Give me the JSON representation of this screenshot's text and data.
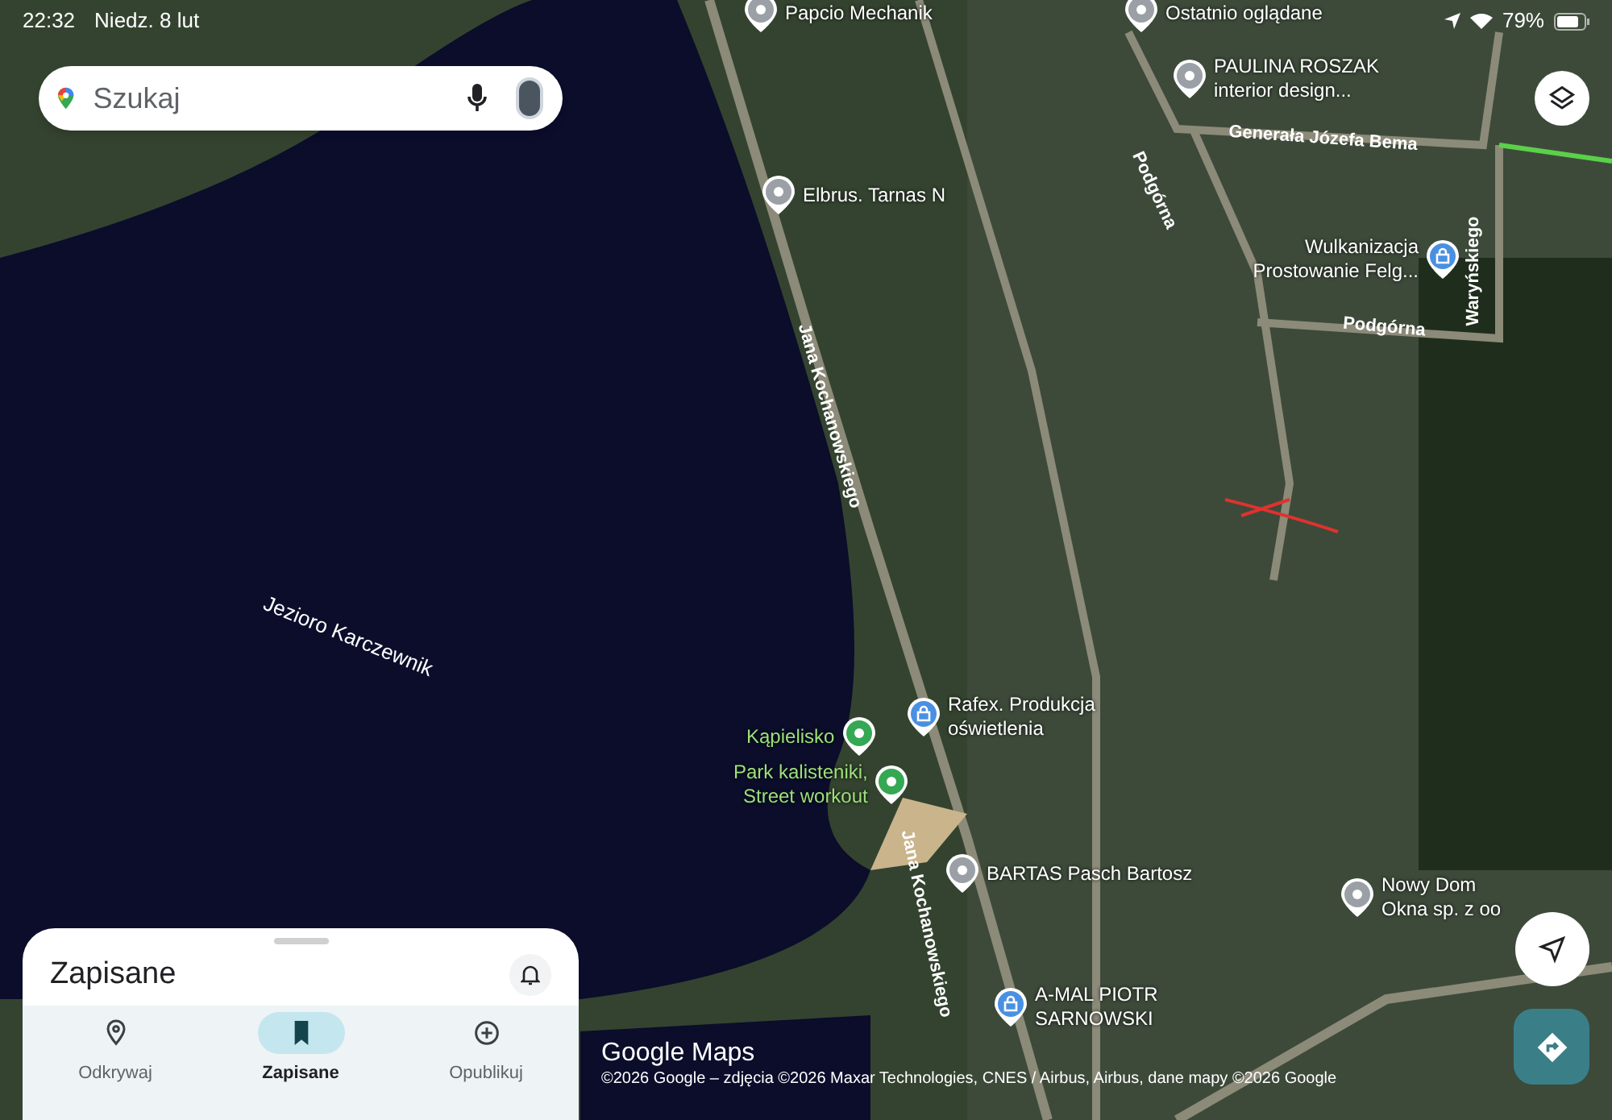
{
  "status_bar": {
    "time": "22:32",
    "date": "Niedz. 8 lut",
    "battery": "79%"
  },
  "search": {
    "placeholder": "Szukaj"
  },
  "map": {
    "water_label": "Jezioro Karczewnik",
    "roads": [
      {
        "name": "Generała Józefa Bema"
      },
      {
        "name": "Podgórna"
      },
      {
        "name": "Podgórna"
      },
      {
        "name": "Waryńskiego"
      },
      {
        "name": "Jana Kochanowskiego"
      },
      {
        "name": "Jana Kochanowskiego"
      }
    ],
    "places": [
      {
        "kind": "place",
        "lines": [
          "Papcio Mechanik"
        ]
      },
      {
        "kind": "place",
        "lines": [
          "Ostatnio oglądane"
        ]
      },
      {
        "kind": "place",
        "lines": [
          "PAULINA ROSZAK",
          "interior design..."
        ]
      },
      {
        "kind": "place",
        "lines": [
          "Elbrus. Tarnas N"
        ]
      },
      {
        "kind": "shop",
        "lines": [
          "Wulkanizacja",
          "Prostowanie Felg..."
        ]
      },
      {
        "kind": "shop",
        "lines": [
          "Rafex. Produkcja",
          "oświetlenia"
        ]
      },
      {
        "kind": "park",
        "lines": [
          "Kąpielisko"
        ]
      },
      {
        "kind": "park",
        "lines": [
          "Park kalisteniki,",
          "Street workout"
        ]
      },
      {
        "kind": "place",
        "lines": [
          "BARTAS Pasch Bartosz"
        ]
      },
      {
        "kind": "shop",
        "lines": [
          "A-MAL PIOTR",
          "SARNOWSKI"
        ]
      },
      {
        "kind": "place",
        "lines": [
          "Nowy Dom",
          "Okna sp. z oo"
        ]
      }
    ],
    "logo": "Google Maps",
    "attribution": "©2026 Google – zdjęcia ©2026 Maxar Technologies, CNES / Airbus, Airbus, dane mapy ©2026 Google"
  },
  "sheet": {
    "title": "Zapisane",
    "tabs": [
      {
        "label": "Odkrywaj",
        "selected": false
      },
      {
        "label": "Zapisane",
        "selected": true
      },
      {
        "label": "Opublikuj",
        "selected": false
      }
    ]
  }
}
